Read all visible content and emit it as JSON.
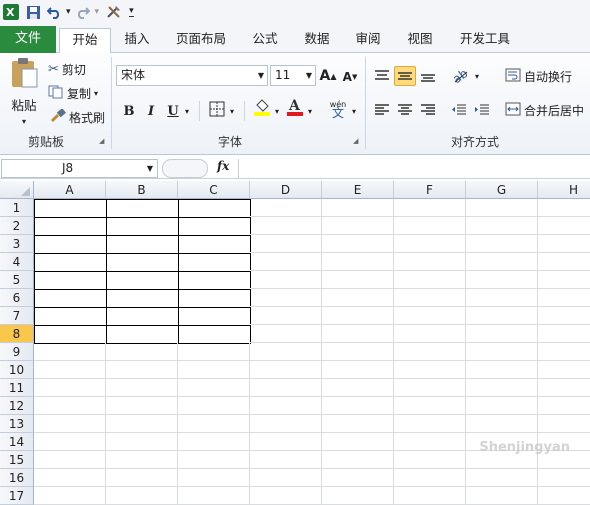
{
  "app": {
    "name": "Microsoft Excel 2010"
  },
  "colors": {
    "file_tab": "#2a8a3e",
    "selected_row_header": "#f8c74b",
    "ribbon_border": "#b9c9da"
  },
  "qat": {
    "undo_arrow": "▾",
    "customize": "▾"
  },
  "tabs": [
    "文件",
    "开始",
    "插入",
    "页面布局",
    "公式",
    "数据",
    "审阅",
    "视图",
    "开发工具"
  ],
  "active_tab": "开始",
  "clipboard": {
    "paste": "粘贴",
    "cut": "剪切",
    "copy": "复制",
    "format_painter": "格式刷",
    "group": "剪贴板"
  },
  "font": {
    "name": "宋体",
    "size": "11",
    "grow": "A",
    "shrink": "A",
    "bold": "B",
    "italic": "I",
    "underline": "U",
    "phonetic_top": "wén",
    "phonetic": "文",
    "group": "字体"
  },
  "alignment": {
    "wrap_text": "自动换行",
    "merge_center": "合并后居中",
    "group": "对齐方式"
  },
  "formula_bar": {
    "name_box": "J8",
    "fx": "fx",
    "value": ""
  },
  "columns": [
    "A",
    "B",
    "C",
    "D",
    "E",
    "F",
    "G",
    "H"
  ],
  "rows": [
    "1",
    "2",
    "3",
    "4",
    "5",
    "6",
    "7",
    "8",
    "9",
    "10",
    "11",
    "12",
    "13",
    "14",
    "15",
    "16",
    "17"
  ],
  "selected_cell": "J8",
  "watermark": "Shenjingyan"
}
